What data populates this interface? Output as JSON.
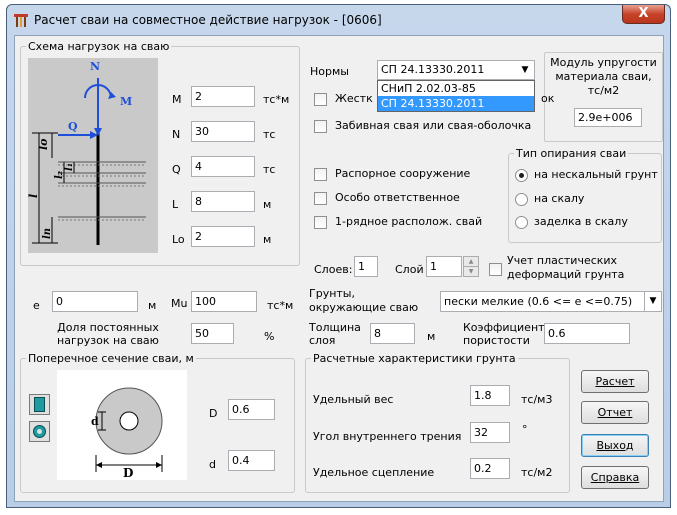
{
  "window": {
    "title": "Расчет сваи на совместное действие нагрузок - [0606]",
    "close_glyph": "X"
  },
  "loads_group": {
    "legend": "Схема нагрузок на сваю",
    "diagram_labels": {
      "N": "N",
      "M": "M",
      "Q": "Q",
      "lo": "lo",
      "l": "l",
      "l1": "l₁",
      "l2": "l₂",
      "ln": "ln"
    },
    "fields": [
      {
        "label": "M",
        "value": "2",
        "unit": "тс*м"
      },
      {
        "label": "N",
        "value": "30",
        "unit": "тс"
      },
      {
        "label": "Q",
        "value": "4",
        "unit": "тс"
      },
      {
        "label": "L",
        "value": "8",
        "unit": "м"
      },
      {
        "label": "Lo",
        "value": "2",
        "unit": "м"
      }
    ]
  },
  "norms": {
    "label": "Нормы",
    "selected": "СП 24.13330.2011",
    "options": [
      "СНиП 2.02.03-85",
      "СП 24.13330.2011"
    ],
    "highlighted_index": 1
  },
  "modulus": {
    "label": "Модуль упругости материала сваи, тс/м2",
    "line1": "Модуль упругости",
    "line2": "материала сваи,",
    "line3": "тс/м2",
    "value": "2.9e+006"
  },
  "checks": {
    "rigid": {
      "label": "Жестк",
      "suffix": "ок",
      "checked": false
    },
    "driven": {
      "label": "Забивная свая или свая-оболочка",
      "checked": false
    },
    "strut": {
      "label": "Распорное сооружение",
      "checked": false
    },
    "critical": {
      "label": "Особо ответственное",
      "checked": false
    },
    "single_row": {
      "label": "1-рядное располож. свай",
      "checked": false
    },
    "plastic": {
      "label_line1": "Учет пластических",
      "label_line2": "деформаций грунта",
      "checked": false
    }
  },
  "support": {
    "legend": "Тип опирания сваи",
    "options": [
      {
        "label": "на нескальный грунт",
        "selected": true
      },
      {
        "label": "на скалу",
        "selected": false
      },
      {
        "label": "заделка в скалу",
        "selected": false
      }
    ]
  },
  "layers": {
    "count_label": "Слоев:",
    "count": "1",
    "layer_label": "Слой",
    "layer": "1"
  },
  "ecc": {
    "e_label": "e",
    "e_value": "0",
    "e_unit": "м",
    "mu_label": "Mu",
    "mu_value": "100",
    "mu_unit": "тс*м"
  },
  "soils": {
    "label_line1": "Грунты,",
    "label_line2": "окружающие сваю",
    "selected": "пески мелкие (0.6 <= e <=0.75)"
  },
  "permanent": {
    "label_line1": "Доля постоянных",
    "label_line2": "нагрузок на сваю",
    "value": "50",
    "unit": "%"
  },
  "thickness": {
    "label_line1": "Толщина",
    "label_line2": "слоя",
    "value": "8",
    "unit": "м"
  },
  "porosity": {
    "label_line1": "Коэффициент",
    "label_line2": "пористости",
    "value": "0.6"
  },
  "section": {
    "legend": "Поперечное сечение сваи, м",
    "d_label_big": "D",
    "D_value": "0.6",
    "d_label": "d",
    "d_value": "0.4",
    "diagram_D": "D",
    "diagram_d": "d"
  },
  "soil_props": {
    "legend": "Расчетные характеристики грунта",
    "rows": [
      {
        "label": "Удельный вес",
        "value": "1.8",
        "unit": "тс/м3"
      },
      {
        "label": "Угол внутреннего трения",
        "value": "32",
        "unit": "°"
      },
      {
        "label": "Удельное сцепление",
        "value": "0.2",
        "unit": "тс/м2"
      }
    ]
  },
  "buttons": {
    "calc": "Расчет",
    "report": "Отчет",
    "exit": "Выход",
    "help": "Справка"
  }
}
